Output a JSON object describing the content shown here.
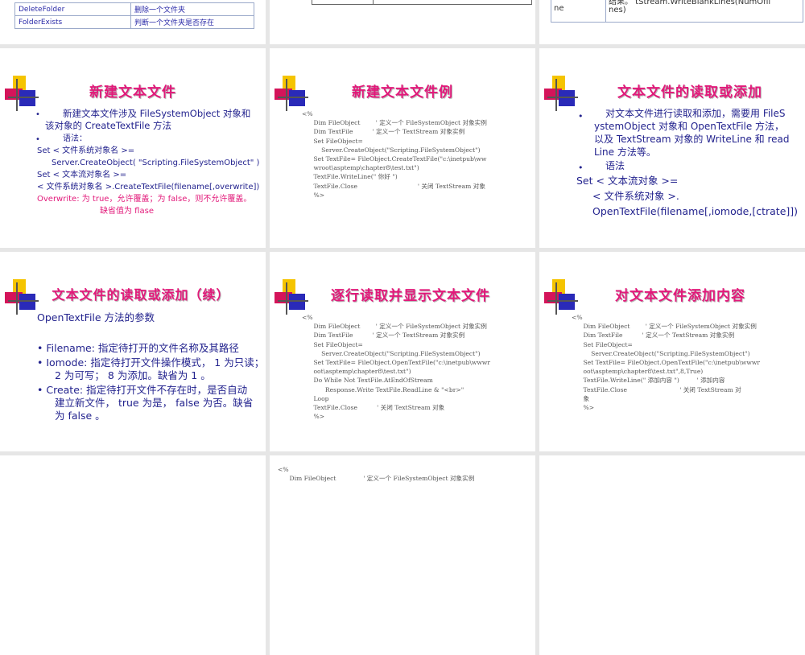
{
  "s1": {
    "rows": [
      [
        "DeleteFolder",
        "删除一个文件夹"
      ],
      [
        "FolderExists",
        "判断一个文件夹是否存在"
      ]
    ]
  },
  "s3": {
    "cell_left": "ne",
    "cell_right": "结果。 tStream.WriteBlankLines(NumOfli",
    "cell_right2": "nes)"
  },
  "s4": {
    "title": "新建文本文件",
    "l1": "新建文本文件涉及 FileSystemObject 对象和",
    "l2": "该对象的 CreateTextFile 方法",
    "l3": "语法：",
    "l4": "Set < 文件系统对象名 >=",
    "l5": "Server.CreateObject( \"Scripting.FileSystemObject\" )",
    "l6": "Set < 文本流对象名 >=",
    "l7": "< 文件系统对象名 >.CreateTextFile(filename[,overwrite])",
    "l8": "Overwrite: 为 true，允许覆盖；为 false，则不允许覆盖。",
    "l9": "缺省值为 flase"
  },
  "s5": {
    "title": "新建文本文件例",
    "code": "<%\n      Dim FileObject        ' 定义一个 FileSystemObject 对象实例\n      Dim TextFile          ' 定义一个 TextStream 对象实例\n      Set FileObject=\n          Server.CreateObject(\"Scripting.FileSystemObject\")\n      Set TextFile= FileObject.CreateTextFile(\"c:\\inetpub\\ww\n      wroot\\asptemp\\chapter8\\test.txt\")\n      TextFile.WriteLine(\" 你好 \")\n      TextFile.Close                               ' 关闭 TextStream 对象\n      %>"
  },
  "s6": {
    "title": "文本文件的读取或添加",
    "l1": "对文本文件进行读取和添加，需要用 FileS",
    "l2": "ystemObject 对象和 OpenTextFile 方法，",
    "l3": "以及 TextStream 对象的 WriteLine 和 read",
    "l4": "Line 方法等。",
    "l5": "语法",
    "l6": "Set < 文本流对象 >=",
    "l7": "< 文件系统对象 >.",
    "l8": "OpenTextFile(filename[,iomode,[ctrate]])"
  },
  "s7": {
    "title": "文本文件的读取或添加（续）",
    "l1": "OpenTextFile 方法的参数",
    "l2": "• Filename:  指定待打开的文件名称及其路径",
    "l3": "• Iomode:  指定待打开文件操作模式， 1 为只读；",
    "l4": "2 为可写；  8 为添加。缺省为 1 。",
    "l5": "• Create:  指定待打开文件不存在时，是否自动",
    "l6": "建立新文件，  true 为是，  false 为否。缺省",
    "l7": "为 false 。"
  },
  "s8": {
    "title": "逐行读取并显示文本文件",
    "code": "<%\n      Dim FileObject        ' 定义一个 FileSystemObject 对象实例\n      Dim TextFile          ' 定义一个 TextStream 对象实例\n      Set FileObject=\n          Server.CreateObject(\"Scripting.FileSystemObject\")\n      Set TextFile= FileObject.OpenTextFile(\"c:\\inetpub\\wwwr\n      oot\\asptemp\\chapter8\\test.txt\")\n      Do While Not TextFile.AtEndOfStream\n            Response.Write TextFile.ReadLine & \"<br>\"\n      Loop\n      TextFile.Close          ' 关闭 TextStream 对象\n      %>"
  },
  "s9": {
    "title": "对文本文件添加内容",
    "code": "<%\n      Dim FileObject        ' 定义一个 FileSystemObject 对象实例\n      Dim TextFile          ' 定义一个 TextStream 对象实例\n      Set FileObject=\n          Server.CreateObject(\"Scripting.FileSystemObject\")\n      Set TextFile= FileObject.OpenTextFile(\"c:\\inetpub\\wwwr\n      oot\\asptemp\\chapter8\\test.txt\",8,True)\n      TextFile.WriteLine(\" 添加内容 \")         ' 添加内容\n      TextFile.Close                           ' 关闭 TextStream 对\n      象\n      %>"
  },
  "s11": {
    "code": "<%\n      Dim FileObject              ' 定义一个 FileSystemObject 对象实例"
  },
  "colors": {
    "title": "#e2197a",
    "text": "#23238e",
    "code": "#555555"
  }
}
